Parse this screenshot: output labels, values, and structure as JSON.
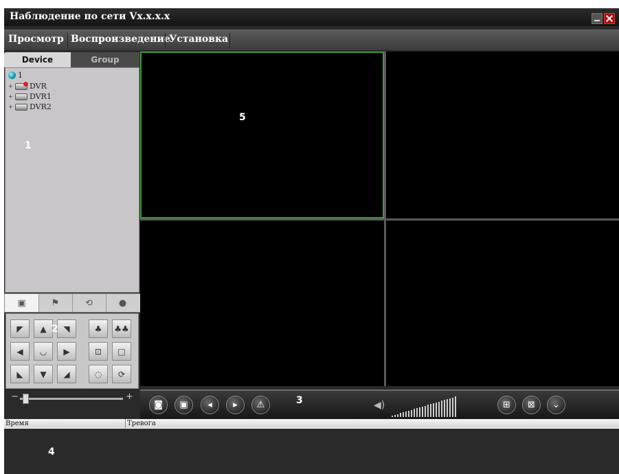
{
  "window": {
    "title": "Наблюдение по сети Vx.x.x.x"
  },
  "menu": [
    "Просмотр",
    "Воспроизведение",
    "Установка"
  ],
  "tabs": {
    "device": "Device",
    "group": "Group"
  },
  "tree": [
    {
      "label": "1",
      "icon": "globe-icon"
    },
    {
      "label": "DVR",
      "icon": "dvr-alarm-icon"
    },
    {
      "label": "DVR1",
      "icon": "dvr-icon"
    },
    {
      "label": "DVR2",
      "icon": "dvr-icon"
    }
  ],
  "labels": {
    "area1": "1",
    "area2": "2",
    "area3": "3",
    "area4": "4",
    "area5": "5"
  },
  "slider": {
    "minus": "−",
    "plus": "+",
    "value": 0.05
  },
  "log": {
    "col_time": "Время",
    "col_alarm": "Тревога"
  },
  "colors": {
    "selected_border": "#3a9a3a",
    "background": "#2a2a2a"
  }
}
